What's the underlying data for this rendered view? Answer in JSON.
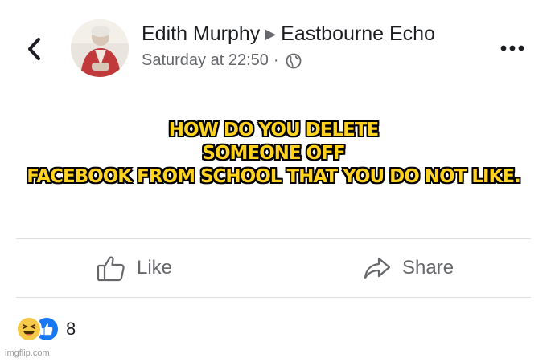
{
  "header": {
    "author": "Edith Murphy",
    "group": "Eastbourne Echo",
    "timestamp": "Saturday at 22:50",
    "privacy_icon": "globe-icon"
  },
  "post": {
    "lines": [
      "HOW DO YOU DELETE",
      "SOMEONE OFF",
      "FACEBOOK FROM SCHOOL THAT YOU DO NOT LIKE."
    ],
    "text_color": "#ffd21f"
  },
  "actions": {
    "like_label": "Like",
    "share_label": "Share"
  },
  "reactions": {
    "icons": [
      "haha-reaction-icon",
      "like-reaction-icon"
    ],
    "count": "8"
  },
  "watermark": "imgflip.com"
}
